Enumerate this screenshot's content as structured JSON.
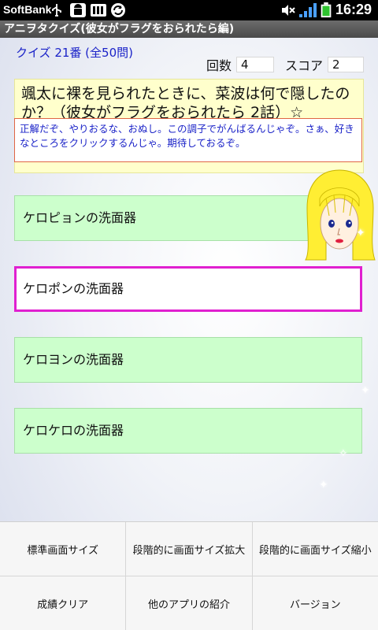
{
  "status_bar": {
    "carrier": "SoftBank",
    "time": "16:29"
  },
  "app": {
    "title": "アニヲタクイズ(彼女がフラグをおられたら編)"
  },
  "quiz": {
    "number_label": "クイズ 21番 (全50問)",
    "attempts_label": "回数",
    "attempts_value": "4",
    "score_label": "スコア",
    "score_value": "2",
    "question": "颯太に裸を見られたときに、菜波は何で隠したのか？（彼女がフラグをおられたら 2話）☆",
    "comment": "正解だぞ、やりおるな、おぬし。この調子でがんばるんじゃぞ。さぁ、好きなところをクリックするんじゃ。期待しておるぞ。"
  },
  "answers": [
    {
      "label": "ケロピョンの洗面器"
    },
    {
      "label": "ケロポンの洗面器"
    },
    {
      "label": "ケロヨンの洗面器"
    },
    {
      "label": "ケロケロの洗面器"
    }
  ],
  "menu": {
    "items": [
      {
        "label": "標準画面サイズ"
      },
      {
        "label": "段階的に画面サイズ拡大"
      },
      {
        "label": "段階的に画面サイズ縮小"
      },
      {
        "label": "成績クリア"
      },
      {
        "label": "他のアプリの紹介"
      },
      {
        "label": "バージョン"
      }
    ]
  },
  "colors": {
    "accent_blue": "#1a22c8",
    "answer_green": "#ccffcc",
    "selected_border": "#e020d0",
    "question_bg": "#ffffcc"
  }
}
